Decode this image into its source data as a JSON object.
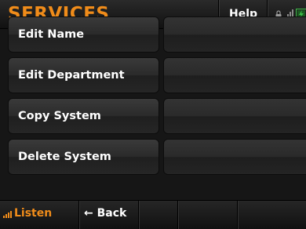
{
  "header": {
    "title": "SERVICES",
    "help_label": "Help",
    "status_icons": [
      "lock-icon",
      "signal-icon",
      "battery-icon"
    ]
  },
  "menu": {
    "items": [
      {
        "label": "Edit Name",
        "value": ""
      },
      {
        "label": "Edit Department",
        "value": ""
      },
      {
        "label": "Copy System",
        "value": ""
      },
      {
        "label": "Delete System",
        "value": ""
      }
    ]
  },
  "footer": {
    "listen_label": "Listen",
    "back_label": "← Back"
  },
  "colors": {
    "accent": "#f08c1a",
    "battery": "#3ec04a"
  }
}
